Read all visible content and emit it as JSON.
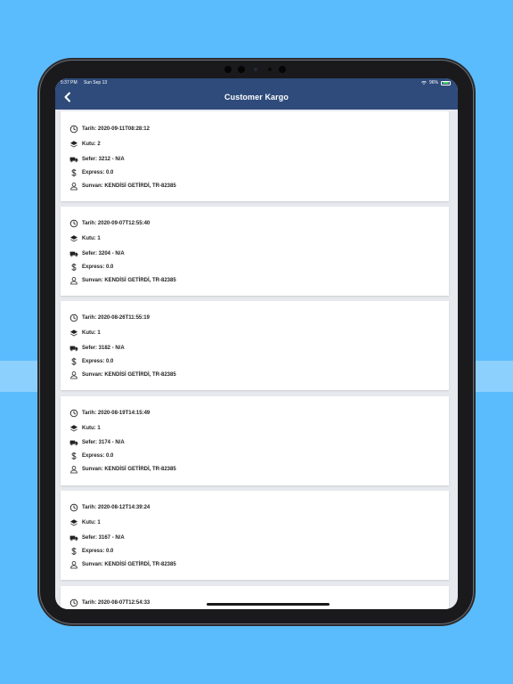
{
  "status_bar": {
    "time": "5:37 PM",
    "date": "Sun Sep 13",
    "battery": "96%",
    "battery_level": 0.96
  },
  "navbar": {
    "title": "Customer Kargo"
  },
  "colors": {
    "navbar_bg": "#2e4b7b",
    "page_bg": "#5bbcfd",
    "screen_bg": "#e8e9ee",
    "card_bg": "#ffffff",
    "text": "#222222"
  },
  "shipments": [
    {
      "tarih": "Tarih: 2020-09-11T08:28:12",
      "kutu": "Kutu: 2",
      "sefer": "Sefer: 3212 -  N/A",
      "express": "Express: 0.0",
      "sunvan": "Sunvan: KENDİSİ GETİRDİ, TR-82385"
    },
    {
      "tarih": "Tarih: 2020-09-07T12:55:40",
      "kutu": "Kutu: 1",
      "sefer": "Sefer: 3204 -  N/A",
      "express": "Express: 0.0",
      "sunvan": "Sunvan: KENDİSİ GETİRDİ, TR-82385"
    },
    {
      "tarih": "Tarih: 2020-08-26T11:55:19",
      "kutu": "Kutu: 1",
      "sefer": "Sefer: 3182 -  N/A",
      "express": "Express: 0.0",
      "sunvan": "Sunvan: KENDİSİ GETİRDİ, TR-82385"
    },
    {
      "tarih": "Tarih: 2020-08-19T14:15:49",
      "kutu": "Kutu: 1",
      "sefer": "Sefer: 3174 -  N/A",
      "express": "Express: 0.0",
      "sunvan": "Sunvan: KENDİSİ GETİRDİ, TR-82385"
    },
    {
      "tarih": "Tarih: 2020-08-12T14:39:24",
      "kutu": "Kutu: 1",
      "sefer": "Sefer: 3167 -  N/A",
      "express": "Express: 0.0",
      "sunvan": "Sunvan: KENDİSİ GETİRDİ, TR-82385"
    },
    {
      "tarih": "Tarih: 2020-08-07T12:54:33"
    }
  ]
}
